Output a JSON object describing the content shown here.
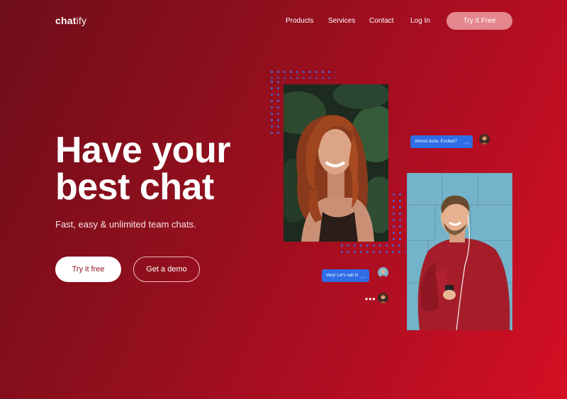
{
  "brand": {
    "logo_bold": "chat",
    "logo_light": "ify"
  },
  "nav": {
    "items": [
      "Products",
      "Services",
      "Contact",
      "Log In"
    ],
    "cta": "Try It Free"
  },
  "hero": {
    "headline_line1": "Have your",
    "headline_line2": "best chat",
    "subline": "Fast, easy & unlimited team chats.",
    "primary_button": "Try it free",
    "secondary_button": "Get a demo"
  },
  "chat": {
    "bubble_top": "Almost done. Excited?",
    "bubble_bottom": "Very! Let's nail it!",
    "typing": "•••"
  },
  "colors": {
    "accent": "#2f6de6",
    "cta_nav_bg": "#e5878f",
    "background_dark": "#6f0d1a",
    "background_light": "#d40f23"
  }
}
